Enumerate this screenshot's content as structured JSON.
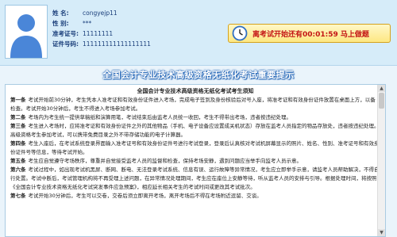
{
  "candidate": {
    "name_label": "姓    名:",
    "name_value": "congyejp11",
    "gender_label": "性    别:",
    "gender_value": "***",
    "admission_label": "准考证号:",
    "admission_value": "11111111",
    "id_label": "证件号码:",
    "id_value": "111111111111111111"
  },
  "notice": {
    "text": "离考试开始还有00:01:59  马上做题"
  },
  "title": "全国会计专业技术高级资格无纸化考试重要提示",
  "rules": {
    "heading": "全国会计专业技术高级资格无纸化考试考生须知",
    "items": [
      {
        "label": "第一条",
        "text": "考试开始前30分钟，考生凭本人准考证和有效身份证件进入考场，完成电子签到及身份核验后对号入座，将准考证和有效身份证件放置在桌面上方，以备检查。考试开始30分钟后，考生不得进入考场参加考试。"
      },
      {
        "label": "第二条",
        "text": "考场内为考生统一提供草稿纸和演算用笔，考试结束后由监考人员统一收回，考生不得带出考场，违者按违纪处理。"
      },
      {
        "label": "第三条",
        "text": "考生进入考场时，应将准考证和有效身份证件之外的其他物品（手机、电子设备应设置成关机状态）存放在监考人员指定的物品存放处，违者按违纪处理。高级资格考生参加考试，可以携带免费目录之外不带存储功能的电子计算器。"
      },
      {
        "label": "第四条",
        "text": "考生入座后，在考试系统登录界面输入准考证号和有效身份证件号进行考试登录，登录后认真核对考试机屏幕显示的照片、姓名、性别、准考证号和有效身份证件号等信息，等待考试开始。"
      },
      {
        "label": "第五条",
        "text": "考生应自觉遵守考场秩序，尊重并自觉接受监考人员的监督和检查，保持考场安静，遇到问题应当举手向监考人员示意。"
      },
      {
        "label": "第六条",
        "text": "考试过程中，如出现考试机黑屏、断网、断电、无法登录考试系统、信息有误、运行故障等异常情况，考生应立即举手示意，请监考人员帮助解决，不得自行处置。考试中断后，考试管理机构将不再受理上述问题，在异常情况处理期间，考生应在座位上安静等待，听从监考人员的安排与引导。根据处理时间，将按照《全国会计专业技术资格无纸化考试突发事件应急预案》，相应延长相关考生的考试时间或更改其考试批次。"
      },
      {
        "label": "第七条",
        "text": "考试开始30分钟后，考生可以交卷，交卷后须立即离开考场，离开考场后不得在考场附近逗留、交谈。"
      }
    ]
  }
}
